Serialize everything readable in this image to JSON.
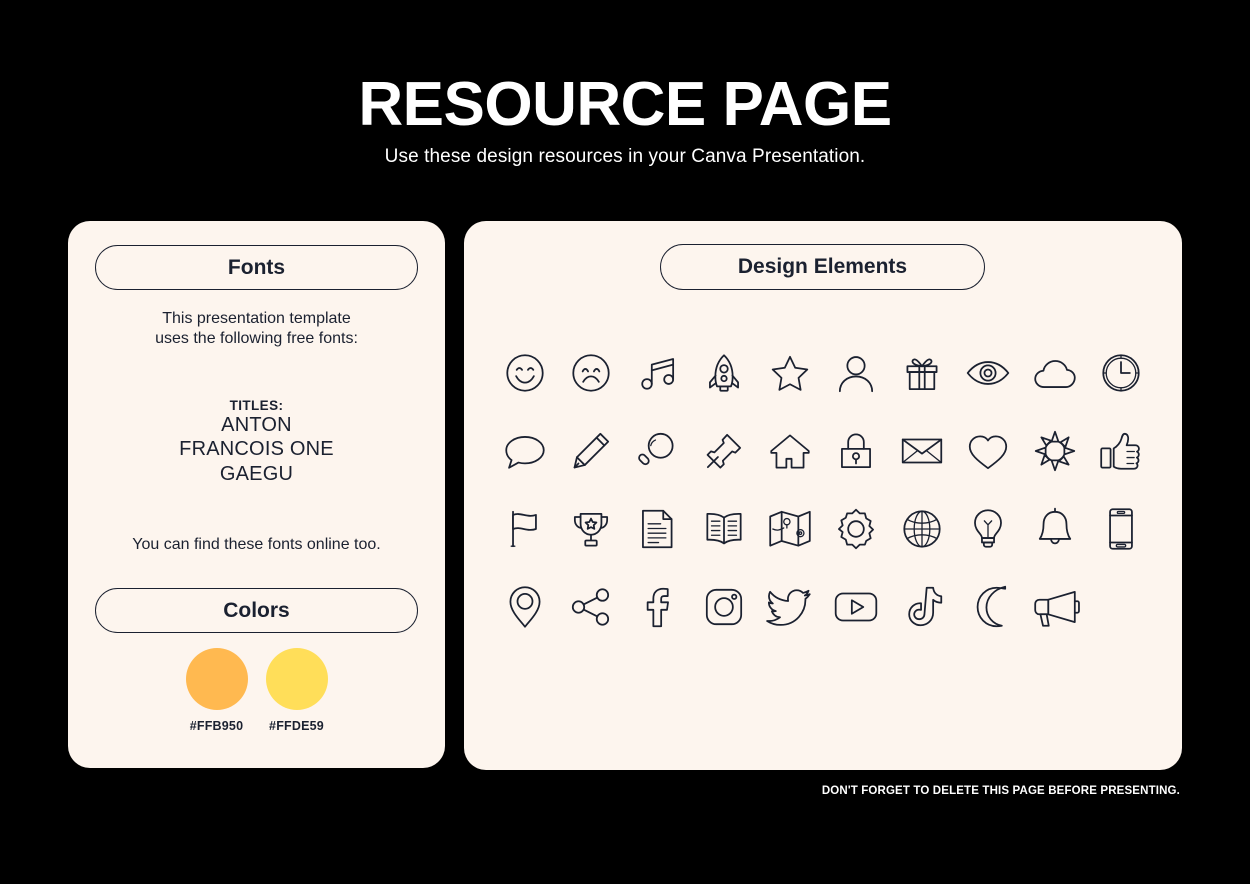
{
  "header": {
    "title": "RESOURCE PAGE",
    "subtitle": "Use these design resources in your Canva Presentation."
  },
  "fonts_panel": {
    "pill_label": "Fonts",
    "intro": "This presentation template\nuses the following free fonts:",
    "titles_label": "TITLES:",
    "titles_fonts": "ANTON\nFRANCOIS ONE\nGAEGU",
    "outro": "You can find these fonts online too."
  },
  "colors_panel": {
    "pill_label": "Colors",
    "swatches": [
      {
        "hex": "#FFB950",
        "label": "#FFB950"
      },
      {
        "hex": "#FFDE59",
        "label": "#FFDE59"
      }
    ]
  },
  "elements_panel": {
    "pill_label": "Design Elements",
    "icons": [
      "smiley-face-icon",
      "sad-face-icon",
      "music-note-icon",
      "rocket-icon",
      "star-icon",
      "person-icon",
      "gift-icon",
      "eye-icon",
      "cloud-icon",
      "clock-icon",
      "speech-bubble-icon",
      "pencil-icon",
      "magnifying-glass-icon",
      "pushpin-icon",
      "house-icon",
      "lock-icon",
      "envelope-icon",
      "heart-icon",
      "sun-icon",
      "thumbs-up-icon",
      "flag-icon",
      "trophy-icon",
      "document-icon",
      "open-book-icon",
      "map-icon",
      "gear-icon",
      "globe-icon",
      "lightbulb-icon",
      "bell-icon",
      "smartphone-icon",
      "location-pin-icon",
      "share-icon",
      "facebook-icon",
      "instagram-icon",
      "twitter-icon",
      "youtube-icon",
      "tiktok-icon",
      "moon-icon",
      "megaphone-icon"
    ]
  },
  "footer": {
    "note": "DON'T FORGET TO DELETE THIS PAGE BEFORE PRESENTING."
  },
  "theme": {
    "background": "#000000",
    "panel_background": "#FDF5EE",
    "ink": "#1B2130",
    "text_on_dark": "#FFFFFF"
  }
}
